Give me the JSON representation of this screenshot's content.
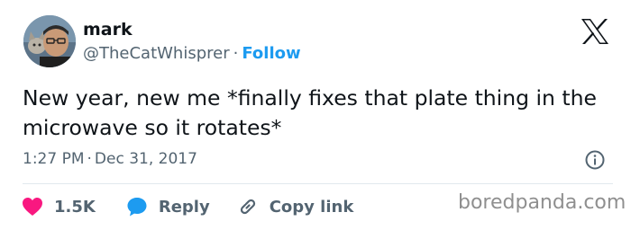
{
  "author": {
    "name": "mark",
    "handle": "@TheCatWhisprer",
    "separator": "·",
    "follow_label": "Follow"
  },
  "tweet": {
    "text": "New year, new me *finally fixes that plate thing in the microwave so it rotates*",
    "time": "1:27 PM",
    "separator": "·",
    "date": "Dec 31, 2017"
  },
  "actions": {
    "like_count": "1.5K",
    "reply_label": "Reply",
    "copy_label": "Copy link"
  },
  "watermark": "boredpanda.com",
  "icons": {
    "logo": "x-logo-icon",
    "info": "info-icon",
    "like": "heart-icon",
    "reply": "speech-bubble-icon",
    "copy": "link-icon"
  },
  "colors": {
    "like": "#f91880",
    "reply": "#1d9bf0",
    "follow": "#1d9bf0",
    "secondary_text": "#536471"
  }
}
